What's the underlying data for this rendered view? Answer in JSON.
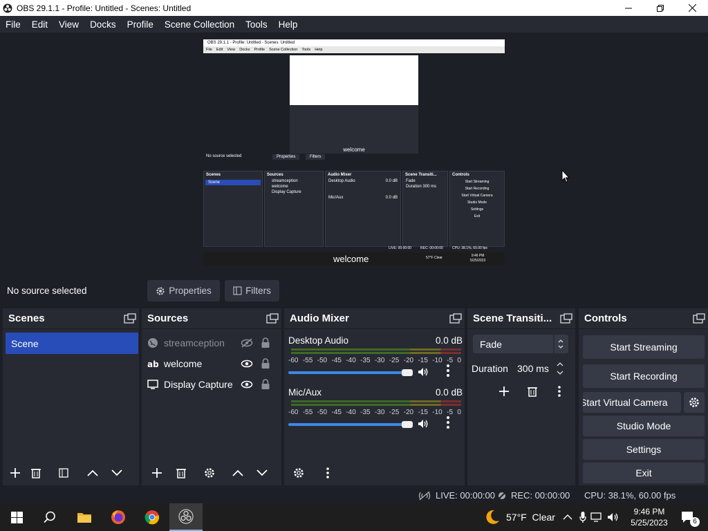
{
  "window": {
    "title": "OBS 29.1.1 - Profile: Untitled - Scenes: Untitled"
  },
  "menu": [
    "File",
    "Edit",
    "View",
    "Docks",
    "Profile",
    "Scene Collection",
    "Tools",
    "Help"
  ],
  "preview": {
    "inner_title": "OBS 29.1.1 - Profile: Untitled - Scenes: Untitled",
    "inner_menu": [
      "File",
      "Edit",
      "View",
      "Docks",
      "Profile",
      "Scene Collection",
      "Tools",
      "Help"
    ],
    "welcome_small": "welcome",
    "welcome_large": "welcome",
    "no_source": "No source selected",
    "properties": "Properties",
    "filters": "Filters",
    "scenes": "Scenes",
    "scene": "Scene",
    "sources": "Sources",
    "src_items": [
      "streamception",
      "welcome",
      "Display Capture"
    ],
    "mixer": "Audio Mixer",
    "desktop": "Desktop Audio",
    "mic": "Mic/Aux",
    "db": "0.0 dB",
    "transitions": "Scene Transiti...",
    "fade": "Fade",
    "duration": "Duration",
    "duration_val": "300 ms",
    "controls": "Controls",
    "ctl_items": [
      "Start Streaming",
      "Start Recording",
      "Start Virtual Camera",
      "Studio Mode",
      "Settings",
      "Exit"
    ],
    "live": "LIVE: 00:00:00",
    "rec": "REC: 00:00:00",
    "cpu": "CPU: 38.1%, 60.00 fps",
    "weather": "57°F Clear",
    "time": "9:46 PM",
    "date": "5/25/2023"
  },
  "context": {
    "status": "No source selected",
    "properties": "Properties",
    "filters": "Filters"
  },
  "scenes": {
    "title": "Scenes",
    "items": [
      "Scene"
    ]
  },
  "sources": {
    "title": "Sources",
    "items": [
      "streamception",
      "welcome",
      "Display Capture"
    ]
  },
  "mixer": {
    "title": "Audio Mixer",
    "channels": [
      {
        "name": "Desktop Audio",
        "level": "0.0 dB"
      },
      {
        "name": "Mic/Aux",
        "level": "0.0 dB"
      }
    ],
    "scale": [
      "-60",
      "-55",
      "-50",
      "-45",
      "-40",
      "-35",
      "-30",
      "-25",
      "-20",
      "-15",
      "-10",
      "-5",
      "0"
    ]
  },
  "transitions": {
    "title": "Scene Transiti...",
    "selected": "Fade",
    "duration_label": "Duration",
    "duration_value": "300 ms"
  },
  "controls": {
    "title": "Controls",
    "start_streaming": "Start Streaming",
    "start_recording": "Start Recording",
    "start_virtual_camera": "Start Virtual Camera",
    "studio_mode": "Studio Mode",
    "settings": "Settings",
    "exit": "Exit"
  },
  "status": {
    "live": "LIVE: 00:00:00",
    "rec": "REC: 00:00:00",
    "cpu": "CPU: 38.1%, 60.00 fps"
  },
  "taskbar": {
    "weather": "57°F  Clear",
    "time": "9:46 PM",
    "date": "5/25/2023",
    "notifications": "6"
  },
  "colors": {
    "accent": "#284cb8",
    "panel": "#272a33",
    "background": "#1d1f26",
    "slider": "#3e88e8"
  }
}
